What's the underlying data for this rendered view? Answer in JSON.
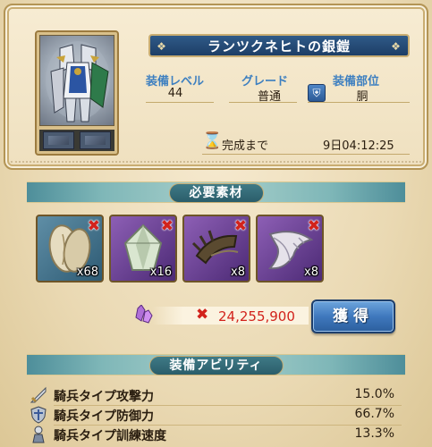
{
  "equipment": {
    "name": "ランツクネヒトの銀鎧",
    "stats": [
      {
        "label": "装備レベル",
        "value": "44"
      },
      {
        "label": "グレード",
        "value": "普通"
      },
      {
        "label": "装備部位",
        "value": "胴"
      }
    ],
    "timer": {
      "label": "完成まで",
      "value": "9日04:12:25"
    }
  },
  "materials_section": {
    "title": "必要素材",
    "items": [
      {
        "icon": "cotton-material-icon",
        "count": "x68"
      },
      {
        "icon": "crystal-material-icon",
        "count": "x16"
      },
      {
        "icon": "claw-material-icon",
        "count": "x8"
      },
      {
        "icon": "feather-material-icon",
        "count": "x8"
      }
    ]
  },
  "cost": {
    "value": "24,255,900"
  },
  "acquire_button": "獲得",
  "ability_section": {
    "title": "装備アビリティ",
    "items": [
      {
        "name": "騎兵タイプ攻撃力",
        "value": "15.0%",
        "icon": "sword-icon"
      },
      {
        "name": "騎兵タイプ防御力",
        "value": "66.7%",
        "icon": "shield-icon"
      },
      {
        "name": "騎兵タイプ訓練速度",
        "value": "13.3%",
        "icon": "knight-icon"
      }
    ]
  },
  "colors": {
    "accent_blue": "#3d7fc0",
    "missing_red": "#d2231c",
    "banner_navy": "#1d3e66",
    "section_teal": "#2a5d6a"
  }
}
